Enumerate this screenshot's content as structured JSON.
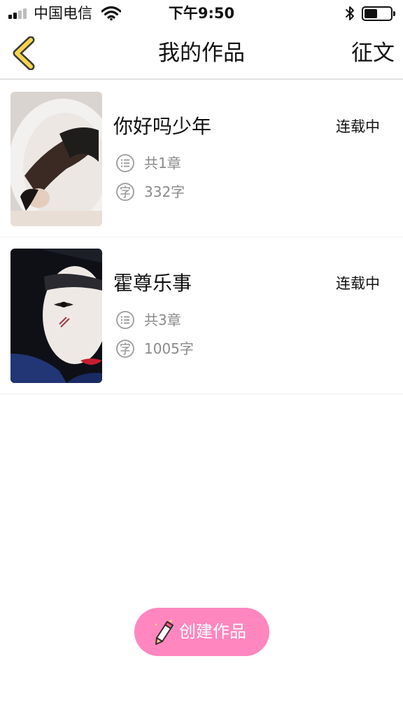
{
  "status_bar": {
    "carrier": "中国电信",
    "time": "下午9:50",
    "battery_level": 0.5
  },
  "nav": {
    "title": "我的作品",
    "right_action": "征文",
    "back_icon": "chevron-left-icon",
    "accent_color": "#f5d44a"
  },
  "works": [
    {
      "title": "你好吗少年",
      "status": "连载中",
      "chapters": "共1章",
      "words": "332字"
    },
    {
      "title": "霍尊乐事",
      "status": "连载中",
      "chapters": "共3章",
      "words": "1005字"
    }
  ],
  "create_button": {
    "label": "创建作品",
    "color": "#ff86bf"
  }
}
